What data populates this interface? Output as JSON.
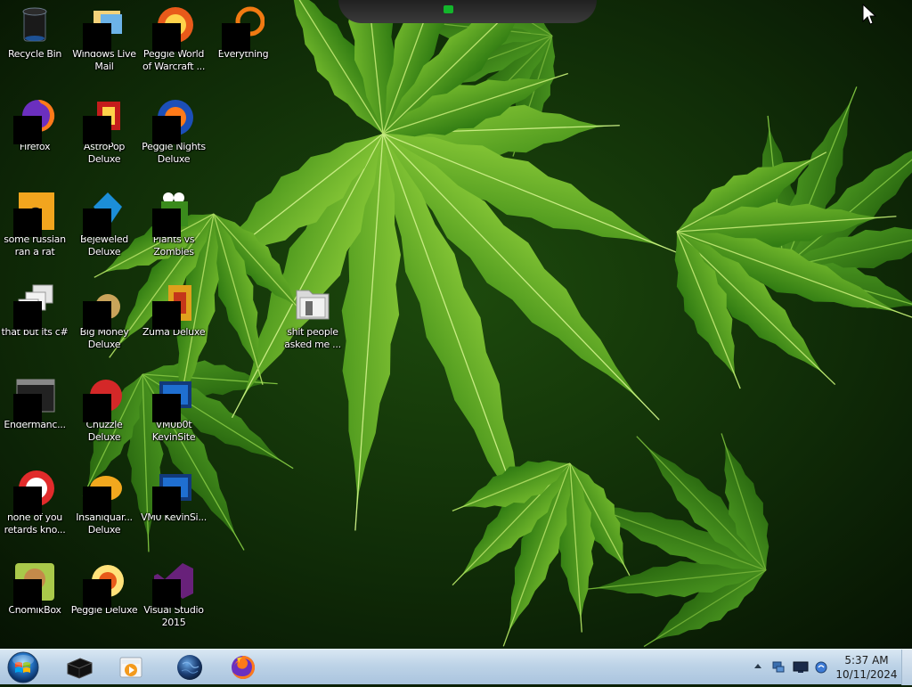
{
  "desktop": {
    "icons": [
      {
        "label": "Recycle Bin",
        "icon": "recycle-bin-icon"
      },
      {
        "label": "Windows Live Mail",
        "icon": "mail-icon"
      },
      {
        "label": "Peggle World of Warcraft ...",
        "icon": "peggle-wow-icon"
      },
      {
        "label": "Everything",
        "icon": "everything-search-icon"
      },
      {
        "label": "Firefox",
        "icon": "firefox-icon"
      },
      {
        "label": "AstroPop Deluxe",
        "icon": "astropop-icon"
      },
      {
        "label": "Peggle Nights Deluxe",
        "icon": "peggle-nights-icon"
      },
      {
        "label": "some russian ran a rat",
        "icon": "script-file-icon"
      },
      {
        "label": "Bejeweled Deluxe",
        "icon": "bejeweled-icon"
      },
      {
        "label": "Plants vs Zombies",
        "icon": "plants-vs-zombies-icon"
      },
      {
        "label": "that but its c#",
        "icon": "stacked-windows-icon"
      },
      {
        "label": "Big Money Deluxe",
        "icon": "big-money-icon"
      },
      {
        "label": "Zuma Deluxe",
        "icon": "zuma-icon"
      },
      {
        "label": "shit people asked me ...",
        "icon": "folder-icon"
      },
      {
        "label": "Endermanc...",
        "icon": "terminal-app-icon"
      },
      {
        "label": "Chuzzle Deluxe",
        "icon": "chuzzle-icon"
      },
      {
        "label": "VM0b0t KevinSite",
        "icon": "vm-shortcut-icon"
      },
      {
        "label": "none of you retards kno...",
        "icon": "opera-like-icon"
      },
      {
        "label": "Insaniquar... Deluxe",
        "icon": "insaniquarium-icon"
      },
      {
        "label": "VM0 KevinSi...",
        "icon": "vm-shortcut-icon"
      },
      {
        "label": "ChomikBox",
        "icon": "chomikbox-icon"
      },
      {
        "label": "Peggle Deluxe",
        "icon": "peggle-icon"
      },
      {
        "label": "Visual Studio 2015",
        "icon": "visual-studio-icon"
      }
    ]
  },
  "taskbar": {
    "pinned": [
      {
        "name": "Start",
        "icon": "windows-start-orb-icon"
      },
      {
        "name": "Terminal",
        "icon": "black-box-icon"
      },
      {
        "name": "Media Player",
        "icon": "media-player-icon"
      },
      {
        "name": "Globe",
        "icon": "globe-icon"
      },
      {
        "name": "Firefox",
        "icon": "firefox-icon"
      }
    ],
    "tray": {
      "icons": [
        "show-hidden-icons-arrow",
        "network-icon",
        "monitor-icon",
        "speaker-icon"
      ]
    },
    "clock": {
      "time": "5:37 AM",
      "date": "10/11/2024"
    }
  },
  "colors": {
    "taskbar_top": "#d9e7f3",
    "taskbar_bottom": "#aac4de",
    "leaf_green": "#3f8f1c",
    "background_dark": "#0c2206"
  }
}
